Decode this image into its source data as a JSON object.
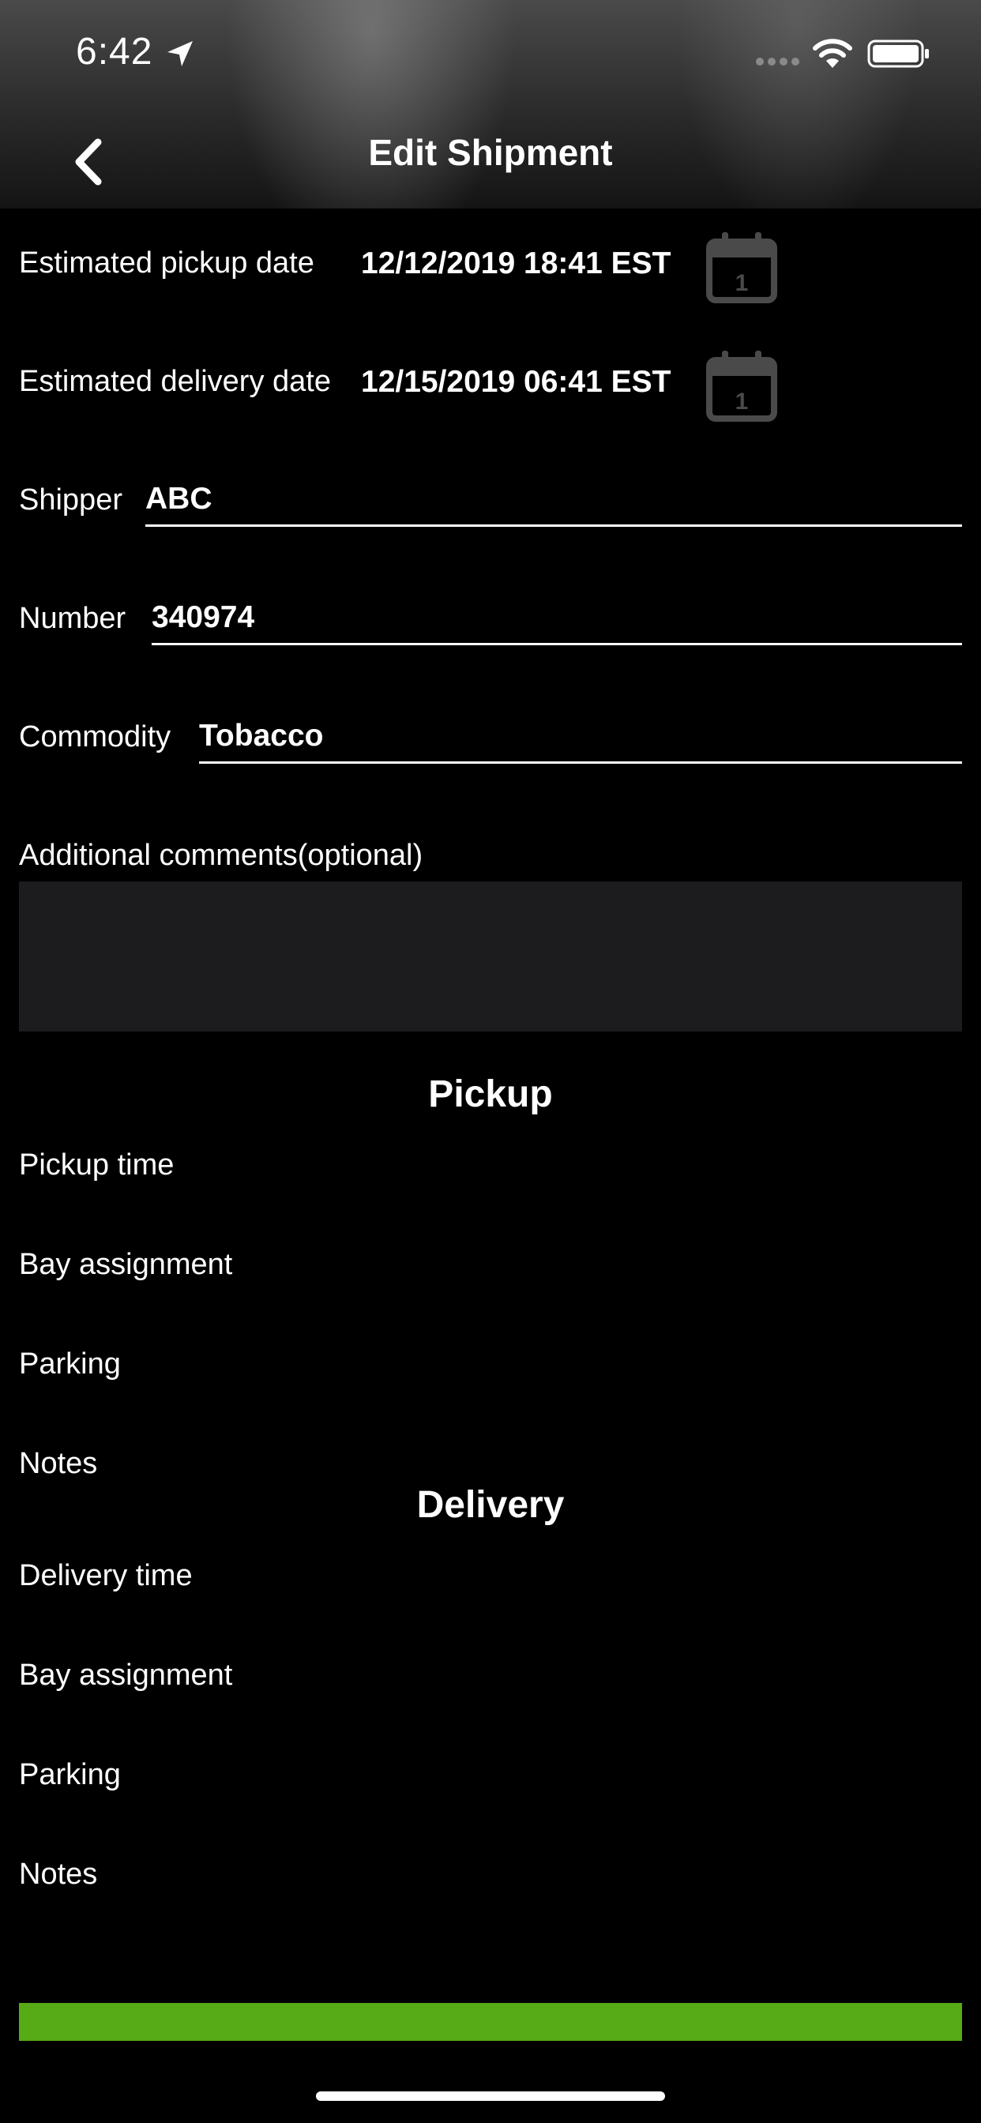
{
  "status_bar": {
    "time": "6:42"
  },
  "nav": {
    "title": "Edit Shipment"
  },
  "dates": {
    "pickup_label": "Estimated pickup date",
    "pickup_value": "12/12/2019 18:41 EST",
    "delivery_label": "Estimated delivery date",
    "delivery_value": "12/15/2019 06:41 EST",
    "calendar_day": "1"
  },
  "fields": {
    "shipper_label": "Shipper",
    "shipper_value": "ABC",
    "number_label": "Number",
    "number_value": "340974",
    "commodity_label": "Commodity",
    "commodity_value": "Tobacco",
    "comments_label": "Additional comments(optional)",
    "comments_value": ""
  },
  "pickup": {
    "title": "Pickup",
    "items": [
      "Pickup time",
      "Bay assignment",
      "Parking",
      "Notes"
    ]
  },
  "delivery": {
    "title": "Delivery",
    "items": [
      "Delivery time",
      "Bay assignment",
      "Parking",
      "Notes"
    ]
  },
  "colors": {
    "background": "#000000",
    "accent_green": "#56ab17",
    "input_box": "#1c1c1e",
    "calendar_icon": "#4a4a4a"
  },
  "icons": [
    "location-arrow-icon",
    "signal-icon",
    "wifi-icon",
    "battery-icon",
    "back-chevron-icon",
    "calendar-icon"
  ]
}
